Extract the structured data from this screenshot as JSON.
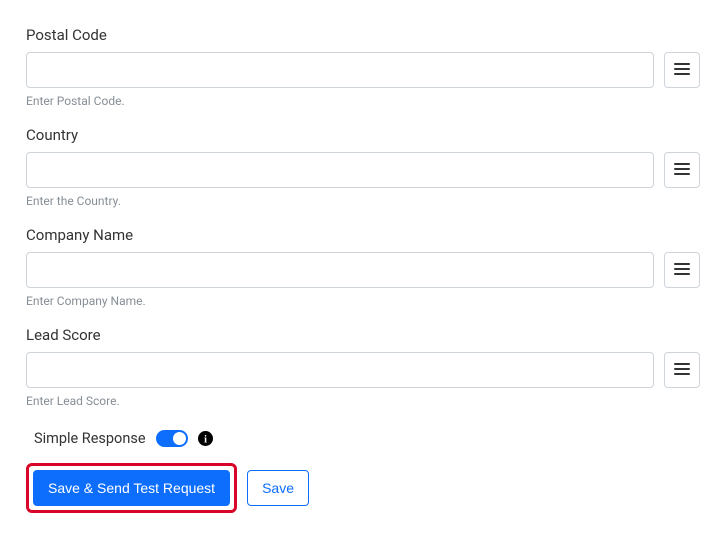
{
  "fields": [
    {
      "label": "Postal Code",
      "value": "",
      "helper": "Enter Postal Code."
    },
    {
      "label": "Country",
      "value": "",
      "helper": "Enter the Country."
    },
    {
      "label": "Company Name",
      "value": "",
      "helper": "Enter Company Name."
    },
    {
      "label": "Lead Score",
      "value": "",
      "helper": "Enter Lead Score."
    }
  ],
  "toggle": {
    "label": "Simple Response",
    "on": true
  },
  "buttons": {
    "primary": "Save & Send Test Request",
    "secondary": "Save"
  }
}
